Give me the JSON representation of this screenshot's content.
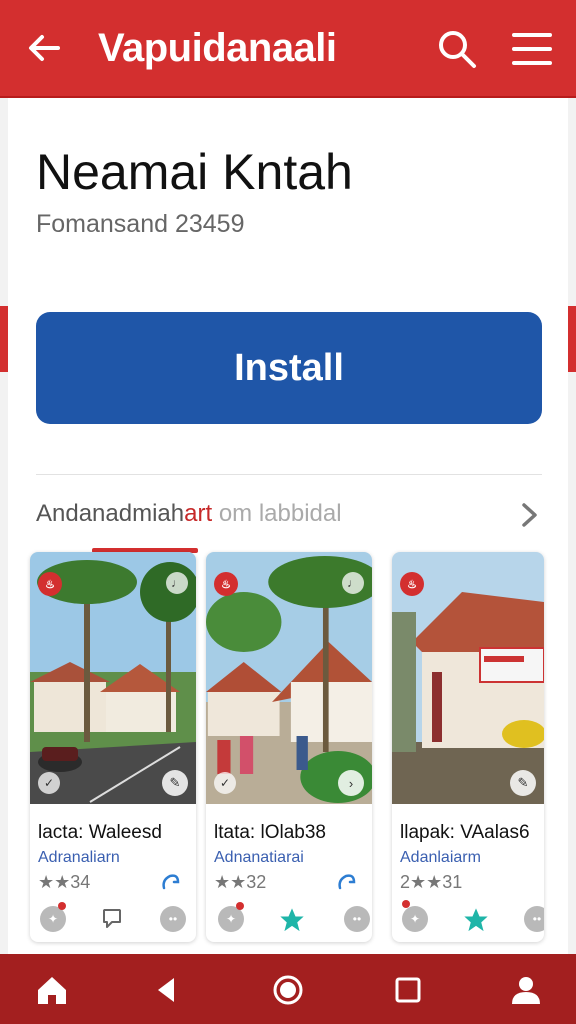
{
  "header": {
    "title": "Vapuidanaali",
    "back_icon": "arrow-left-icon",
    "search_icon": "search-icon",
    "menu_icon": "hamburger-menu-icon"
  },
  "app": {
    "name": "Neamai Kntah",
    "developer": "Fomansand 23459",
    "install_label": "Install"
  },
  "section": {
    "title_main": "Andanadmiah",
    "title_accent": "art",
    "title_rest": "om labbidal"
  },
  "cards": [
    {
      "title": "lacta: Waleesd",
      "subtitle": "Adranaliarn",
      "rating": "★★34"
    },
    {
      "title": "ltata: lOlab38",
      "subtitle": "Adnanatiarai",
      "rating": "★★32"
    },
    {
      "title": "llapak: VAalas6",
      "subtitle": "Adanlaiarm",
      "rating": "2★★31"
    }
  ],
  "bottom_nav": {
    "items": [
      "home-icon",
      "back-triangle-icon",
      "home-circle-icon",
      "recents-square-icon",
      "profile-icon"
    ]
  },
  "colors": {
    "brand_red": "#d32f2f",
    "install_blue": "#1f56a8",
    "nav_bar": "#a31f1f",
    "teal_star": "#1fb5a8"
  }
}
